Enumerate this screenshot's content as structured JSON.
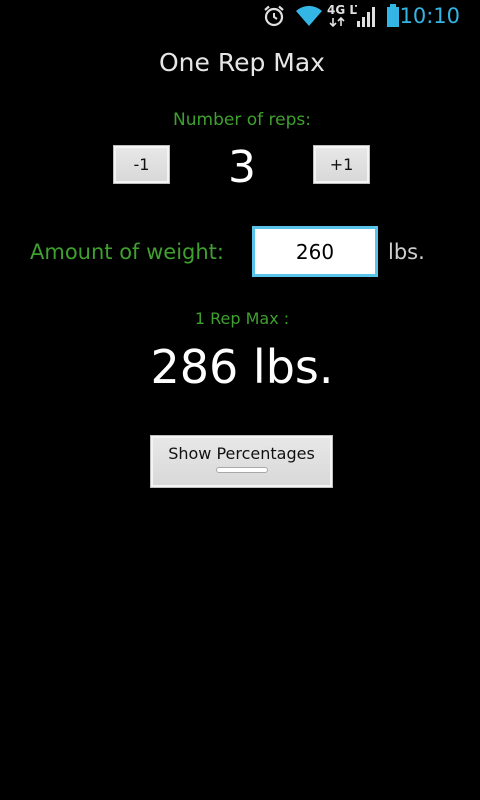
{
  "status_bar": {
    "time": "10:10",
    "network": "4G LTE",
    "icons": [
      "alarm-icon",
      "wifi-icon",
      "lte-icon",
      "signal-icon",
      "battery-icon"
    ],
    "accent_color": "#33b5e5"
  },
  "app": {
    "title": "One Rep Max"
  },
  "reps": {
    "label": "Number of reps:",
    "decrement_label": "-1",
    "increment_label": "+1",
    "value": "3"
  },
  "weight": {
    "label": "Amount of weight:",
    "value": "260",
    "unit": "lbs."
  },
  "result": {
    "label": "1 Rep Max :",
    "value": "286 lbs."
  },
  "actions": {
    "show_percentages_label": "Show Percentages"
  },
  "colors": {
    "label_green": "#3fa02f",
    "background": "#000000",
    "input_border": "#5ac3ea"
  }
}
